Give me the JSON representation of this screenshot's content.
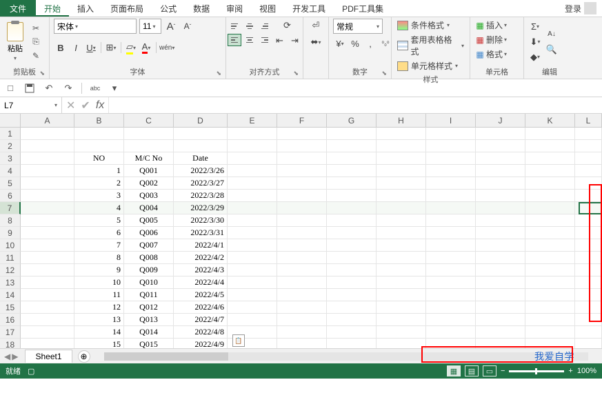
{
  "tabs": {
    "file": "文件",
    "home": "开始",
    "insert": "插入",
    "layout": "页面布局",
    "formula": "公式",
    "data": "数据",
    "review": "审阅",
    "view": "视图",
    "dev": "开发工具",
    "pdf": "PDF工具集"
  },
  "login": "登录",
  "ribbon": {
    "clipboard": {
      "label": "剪贴板",
      "paste": "粘贴"
    },
    "font": {
      "label": "字体",
      "name": "宋体",
      "size": "11",
      "grow": "A",
      "shrink": "A",
      "bold": "B",
      "italic": "I",
      "underline": "U",
      "pinyin": "wén"
    },
    "align": {
      "label": "对齐方式"
    },
    "number": {
      "label": "数字",
      "format": "常规"
    },
    "styles": {
      "label": "样式",
      "cond": "条件格式",
      "table": "套用表格格式",
      "cell": "单元格样式"
    },
    "cells": {
      "label": "单元格",
      "insert": "插入",
      "delete": "删除",
      "format": "格式"
    },
    "editing": {
      "label": "编辑"
    }
  },
  "name_box": "L7",
  "fx": "fx",
  "columns": [
    "A",
    "B",
    "C",
    "D",
    "E",
    "F",
    "G",
    "H",
    "I",
    "J",
    "K",
    "L"
  ],
  "col_widths": [
    "colw-A",
    "colw-B",
    "colw-C",
    "colw-D",
    "colw-E",
    "colw-F",
    "colw-G",
    "colw-H",
    "colw-I",
    "colw-J",
    "colw-K",
    "colw-L"
  ],
  "row_numbers": [
    1,
    2,
    3,
    4,
    5,
    6,
    7,
    8,
    9,
    10,
    11,
    12,
    13,
    14,
    15,
    16,
    17,
    18
  ],
  "selected_row": 7,
  "headers": {
    "no": "NO",
    "mc": "M/C No",
    "date": "Date"
  },
  "chart_data": {
    "type": "table",
    "columns": [
      "NO",
      "M/C No",
      "Date"
    ],
    "rows": [
      [
        1,
        "Q001",
        "2022/3/26"
      ],
      [
        2,
        "Q002",
        "2022/3/27"
      ],
      [
        3,
        "Q003",
        "2022/3/28"
      ],
      [
        4,
        "Q004",
        "2022/3/29"
      ],
      [
        5,
        "Q005",
        "2022/3/30"
      ],
      [
        6,
        "Q006",
        "2022/3/31"
      ],
      [
        7,
        "Q007",
        "2022/4/1"
      ],
      [
        8,
        "Q008",
        "2022/4/2"
      ],
      [
        9,
        "Q009",
        "2022/4/3"
      ],
      [
        10,
        "Q010",
        "2022/4/4"
      ],
      [
        11,
        "Q011",
        "2022/4/5"
      ],
      [
        12,
        "Q012",
        "2022/4/6"
      ],
      [
        13,
        "Q013",
        "2022/4/7"
      ],
      [
        14,
        "Q014",
        "2022/4/8"
      ],
      [
        15,
        "Q015",
        "2022/4/9"
      ]
    ]
  },
  "sheet": {
    "name": "Sheet1"
  },
  "status": {
    "ready": "就绪",
    "zoom": "100%"
  },
  "watermark": "我爱自学",
  "glyphs": {
    "cut": "✂",
    "copy": "⎘",
    "brush": "✎",
    "dd": "▾",
    "sigma": "Σ",
    "sort": "A↓",
    "find": "🔍",
    "fill": "⬇",
    "clear": "◆",
    "percent": "%",
    "comma": ",",
    "inc": ".0",
    "dec": ".00",
    "wrap": "⏎",
    "merge": "⬌",
    "orient": "⟳",
    "indentL": "⇤",
    "indentR": "⇥",
    "minus": "−",
    "plus": "+",
    "first": "⏮",
    "prev": "◀",
    "next": "▶",
    "last": "⏭",
    "add": "⊕",
    "save": "💾",
    "undo": "↶",
    "redo": "↷",
    "new": "□",
    "open": "📂",
    "print": "⎙",
    "abc": "abc",
    "check": "✔",
    "x": "✕",
    "border": "⊞",
    "fillc": "▱",
    "fontc": "A"
  }
}
